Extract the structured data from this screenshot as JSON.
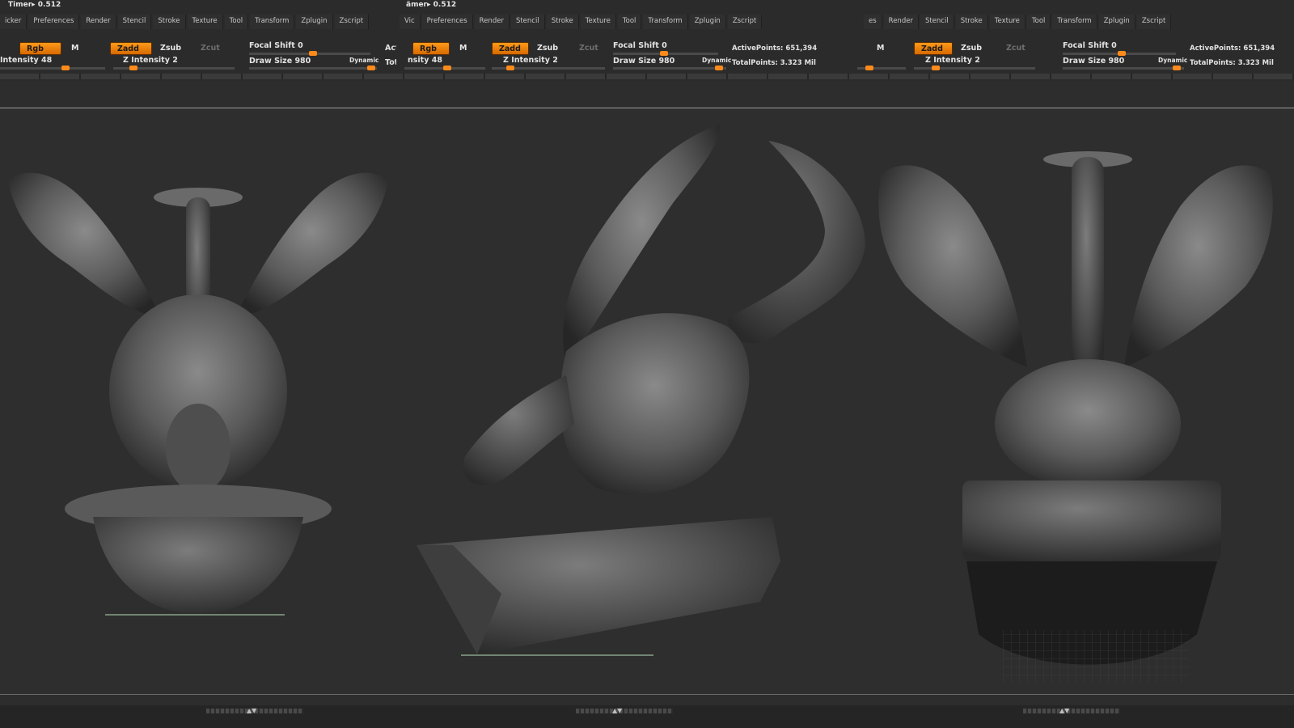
{
  "panels": [
    {
      "timer": "Timer▸ 0.512",
      "menus": [
        "icker",
        "Preferences",
        "Render",
        "Stencil",
        "Stroke",
        "Texture",
        "Tool",
        "Transform",
        "Zplugin",
        "Zscript"
      ],
      "rgb": "Rgb",
      "m": "M",
      "zadd": "Zadd",
      "zsub": "Zsub",
      "zcut": "Zcut",
      "focal": "Focal Shift 0",
      "intensity": "Intensity 48",
      "z_intensity": "Z Intensity 2",
      "draw_size": "Draw Size 980",
      "dynamic": "Dynamic",
      "act": "Act",
      "tot": "Tot"
    },
    {
      "timer": "ämer▸ 0.512",
      "menus": [
        "Vic",
        "Preferences",
        "Render",
        "Stencil",
        "Stroke",
        "Texture",
        "Tool",
        "Transform",
        "Zplugin",
        "Zscript"
      ],
      "rgb": "Rgb",
      "m": "M",
      "zadd": "Zadd",
      "zsub": "Zsub",
      "zcut": "Zcut",
      "focal": "Focal Shift 0",
      "intensity": "nsity 48",
      "z_intensity": "Z Intensity 2",
      "draw_size": "Draw Size 980",
      "dynamic": "Dynamic",
      "active_points": "ActivePoints: 651,394",
      "total_points": "TotalPoints: 3.323 Mil"
    },
    {
      "menus": [
        "es",
        "Render",
        "Stencil",
        "Stroke",
        "Texture",
        "Tool",
        "Transform",
        "Zplugin",
        "Zscript"
      ],
      "m": "M",
      "zadd": "Zadd",
      "zsub": "Zsub",
      "zcut": "Zcut",
      "focal": "Focal Shift 0",
      "z_intensity": "Z Intensity 2",
      "draw_size": "Draw Size 980",
      "dynamic": "Dynamic",
      "active_points": "ActivePoints: 651,394",
      "total_points": "TotalPoints: 3.323 Mil"
    }
  ],
  "colors": {
    "accent": "#ff8a1a",
    "background": "#2e2e2e",
    "stone": "#5e5e5e"
  },
  "viewport": {
    "subject": "stone-dragon-gargoyle-sculpt",
    "views": [
      "front",
      "side",
      "back"
    ]
  }
}
